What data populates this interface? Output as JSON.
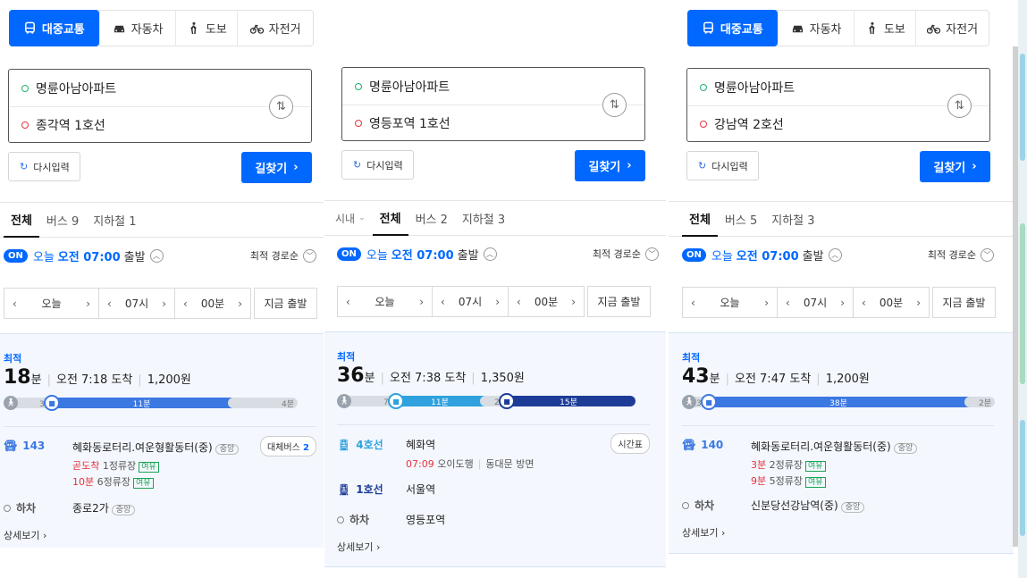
{
  "modes": [
    {
      "label": "대중교통",
      "icon": "bus-icon"
    },
    {
      "label": "자동차",
      "icon": "car-icon"
    },
    {
      "label": "도보",
      "icon": "walk-icon"
    },
    {
      "label": "자전거",
      "icon": "bike-icon"
    }
  ],
  "labels": {
    "reset": "다시입력",
    "find": "길찾기",
    "on": "ON",
    "today": "오늘",
    "depart": "출발",
    "sort": "최적 경로순",
    "best": "최적",
    "min_unit": "분",
    "now_depart": "지금 출발",
    "detail": "상세보기",
    "getoff": "하차",
    "timetable": "시간표",
    "city": "시내"
  },
  "panels": [
    {
      "origin": "명륜아남아파트",
      "destination": "종각역 1호선",
      "tabs": [
        "전체",
        "버스 9",
        "지하철 1"
      ],
      "depart_time": "오전 07:00",
      "selector": {
        "day": "오늘",
        "hour": "07시",
        "minute": "00분"
      },
      "summary": {
        "minutes": "18",
        "arrival": "오전 7:18 도착",
        "fare": "1,200원"
      },
      "segments": [
        {
          "type": "walk",
          "label": "3분",
          "min": 3
        },
        {
          "type": "bus",
          "label": "11분",
          "min": 11
        },
        {
          "type": "walk",
          "label": "4분",
          "min": 4
        }
      ],
      "legs": [
        {
          "type": "bus",
          "line": "143",
          "stop": "혜화동로터리.여운형활동터(중)",
          "tag": "중앙",
          "arrivals": [
            {
              "time": "곧도착",
              "info": "1정류장",
              "status": "여유"
            },
            {
              "time": "10분",
              "info": "6정류장",
              "status": "여유"
            }
          ],
          "alt": "대체버스",
          "alt_count": "2"
        },
        {
          "type": "off",
          "line": "하차",
          "stop": "종로2가",
          "tag": "중앙"
        }
      ]
    },
    {
      "origin": "명륜아남아파트",
      "destination": "영등포역 1호선",
      "tabs": [
        "전체",
        "버스 2",
        "지하철 3"
      ],
      "depart_time": "오전 07:00",
      "selector": {
        "day": "오늘",
        "hour": "07시",
        "minute": "00분"
      },
      "summary": {
        "minutes": "36",
        "arrival": "오전 7:38 도착",
        "fare": "1,350원"
      },
      "segments": [
        {
          "type": "walk",
          "label": "7분",
          "min": 7
        },
        {
          "type": "sub4",
          "label": "11분",
          "min": 11
        },
        {
          "type": "walk",
          "label": "2분",
          "min": 2
        },
        {
          "type": "sub1",
          "label": "15분",
          "min": 15
        }
      ],
      "legs": [
        {
          "type": "sub4",
          "line": "4호선",
          "stop": "혜화역",
          "time": "07:09",
          "direction": "오이도행",
          "exit": "동대문 방면"
        },
        {
          "type": "sub1",
          "line": "1호선",
          "stop": "서울역"
        },
        {
          "type": "off",
          "line": "하차",
          "stop": "영등포역"
        }
      ]
    },
    {
      "origin": "명륜아남아파트",
      "destination": "강남역 2호선",
      "tabs": [
        "전체",
        "버스 5",
        "지하철 3"
      ],
      "depart_time": "오전 07:00",
      "selector": {
        "day": "오늘",
        "hour": "07시",
        "minute": "00분"
      },
      "summary": {
        "minutes": "43",
        "arrival": "오전 7:47 도착",
        "fare": "1,200원"
      },
      "segments": [
        {
          "type": "walk",
          "label": "3분",
          "min": 3
        },
        {
          "type": "bus",
          "label": "38분",
          "min": 38
        },
        {
          "type": "walk",
          "label": "2분",
          "min": 2
        }
      ],
      "legs": [
        {
          "type": "bus",
          "line": "140",
          "stop": "혜화동로터리.여운형활동터(중)",
          "tag": "중앙",
          "arrivals": [
            {
              "time": "3분",
              "info": "2정류장",
              "status": "여유"
            },
            {
              "time": "9분",
              "info": "5정류장",
              "status": "여유"
            }
          ]
        },
        {
          "type": "off",
          "line": "하차",
          "stop": "신분당선강남역(중)",
          "tag": "중앙"
        }
      ]
    }
  ]
}
